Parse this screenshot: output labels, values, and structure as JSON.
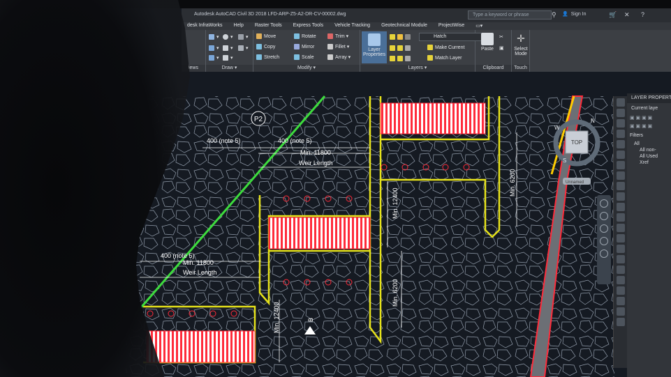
{
  "window": {
    "title": "Autodesk AutoCAD Civil 3D 2018   LFD-ARP-Z5-A2-DR-CV-00002.dwg",
    "search_placeholder": "Type a keyword or phrase",
    "sign_in": "Sign In"
  },
  "tabs": [
    "desk InfraWorks",
    "Help",
    "Raster Tools",
    "Express Tools",
    "Vehicle Tracking",
    "Geotechnical Module",
    "ProjectWise"
  ],
  "ribbon": {
    "panels": {
      "partial": "iews",
      "draw": "Draw ▾",
      "modify": "Modify ▾",
      "layers": "Layers ▾",
      "clipboard": "Clipboard",
      "touch": "Touch"
    },
    "modify_tools": [
      "Move",
      "Rotate",
      "Trim ▾",
      "Copy",
      "Mirror",
      "Fillet ▾",
      "Stretch",
      "Scale",
      "Array ▾"
    ],
    "layer_properties": "Layer Properties",
    "layer_dropdown": "Hatch",
    "make_current": "Make Current",
    "match_layer": "Match Layer",
    "paste": "Paste",
    "select_mode": "Select Mode"
  },
  "drawing": {
    "point_label": "P2",
    "dims": {
      "note_left_top": "400 (note 5)",
      "note_right_top": "400 (note 5)",
      "min_11800_top": "Min. 11800",
      "weir_top": "Weir Length",
      "note_lower": "400 (note 5)",
      "min_11800_lower": "Min. 11800",
      "weir_lower": "Weir Length",
      "min_6200_right": "Min. 6200",
      "min_12400_mid": "Min. 12400",
      "min_6200_mid": "Min. 6200",
      "min_12400_left": "Min. 12400"
    },
    "section_marker": "B"
  },
  "viewcube": {
    "top": "TOP",
    "n": "N",
    "w": "W",
    "s": "S",
    "tooltip": "Unnamed"
  },
  "layer_panel": {
    "header": "LAYER PROPERTIE",
    "current": "Current laye",
    "filters": "Filters",
    "items": [
      "All",
      "All non-",
      "All Used",
      "Xref"
    ]
  },
  "colors": {
    "background": "#151a22",
    "walls": "#e6e21a",
    "hatch_red": "#ff2b3a",
    "green_line": "#3ddc3d",
    "dimension": "#ffffff",
    "rock": "#9aa7b6"
  }
}
